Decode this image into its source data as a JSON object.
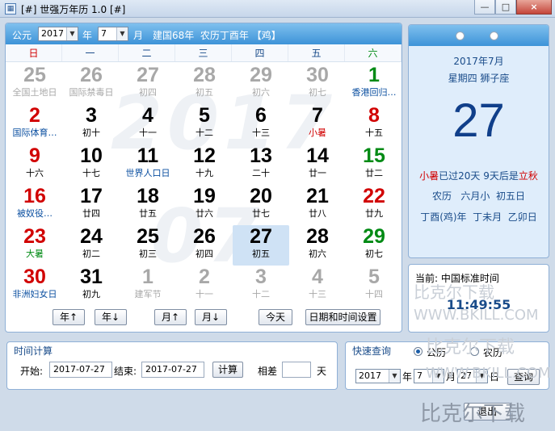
{
  "window": {
    "title": "[#] 世强万年历 1.0 [#]",
    "icon": "calendar-app-icon",
    "controls": [
      "—",
      "□",
      "×"
    ]
  },
  "header": {
    "calendar_type": "公元",
    "year": "2017",
    "year_unit": "年",
    "month": "7",
    "month_unit": "月",
    "info": "建国68年  农历丁酉年 【鸡】"
  },
  "weekdays": [
    "日",
    "一",
    "二",
    "三",
    "四",
    "五",
    "六"
  ],
  "watermark_year": "2017",
  "watermark_month": "07",
  "weeks": [
    [
      {
        "d": "25",
        "s": "全国土地日",
        "t": "o"
      },
      {
        "d": "26",
        "s": "国际禁毒日",
        "t": "o"
      },
      {
        "d": "27",
        "s": "初四",
        "t": "o"
      },
      {
        "d": "28",
        "s": "初五",
        "t": "o"
      },
      {
        "d": "29",
        "s": "初六",
        "t": "o"
      },
      {
        "d": "30",
        "s": "初七",
        "t": "o"
      },
      {
        "d": "1",
        "s": "香港回归…",
        "t": "g",
        "sc": "fest"
      }
    ],
    [
      {
        "d": "2",
        "s": "国际体育…",
        "t": "r",
        "sc": "fest"
      },
      {
        "d": "3",
        "s": "初十",
        "t": "n"
      },
      {
        "d": "4",
        "s": "十一",
        "t": "n"
      },
      {
        "d": "5",
        "s": "十二",
        "t": "n"
      },
      {
        "d": "6",
        "s": "十三",
        "t": "n"
      },
      {
        "d": "7",
        "s": "小暑",
        "t": "n",
        "sc": "term"
      },
      {
        "d": "8",
        "s": "十五",
        "t": "r"
      }
    ],
    [
      {
        "d": "9",
        "s": "十六",
        "t": "r"
      },
      {
        "d": "10",
        "s": "十七",
        "t": "n"
      },
      {
        "d": "11",
        "s": "世界人口日",
        "t": "n",
        "sc": "fest"
      },
      {
        "d": "12",
        "s": "十九",
        "t": "n"
      },
      {
        "d": "13",
        "s": "二十",
        "t": "n"
      },
      {
        "d": "14",
        "s": "廿一",
        "t": "n"
      },
      {
        "d": "15",
        "s": "廿二",
        "t": "g"
      }
    ],
    [
      {
        "d": "16",
        "s": "被奴役…",
        "t": "r",
        "sc": "fest"
      },
      {
        "d": "17",
        "s": "廿四",
        "t": "n"
      },
      {
        "d": "18",
        "s": "廿五",
        "t": "n"
      },
      {
        "d": "19",
        "s": "廿六",
        "t": "n"
      },
      {
        "d": "20",
        "s": "廿七",
        "t": "n"
      },
      {
        "d": "21",
        "s": "廿八",
        "t": "n"
      },
      {
        "d": "22",
        "s": "廿九",
        "t": "r"
      }
    ],
    [
      {
        "d": "23",
        "s": "大暑",
        "t": "r",
        "sc": "term2"
      },
      {
        "d": "24",
        "s": "初二",
        "t": "n"
      },
      {
        "d": "25",
        "s": "初三",
        "t": "n"
      },
      {
        "d": "26",
        "s": "初四",
        "t": "n"
      },
      {
        "d": "27",
        "s": "初五",
        "t": "n",
        "sel": true
      },
      {
        "d": "28",
        "s": "初六",
        "t": "n"
      },
      {
        "d": "29",
        "s": "初七",
        "t": "g"
      }
    ],
    [
      {
        "d": "30",
        "s": "非洲妇女日",
        "t": "r",
        "sc": "fest"
      },
      {
        "d": "31",
        "s": "初九",
        "t": "n"
      },
      {
        "d": "1",
        "s": "建军节",
        "t": "o"
      },
      {
        "d": "2",
        "s": "十一",
        "t": "o"
      },
      {
        "d": "3",
        "s": "十二",
        "t": "o"
      },
      {
        "d": "4",
        "s": "十三",
        "t": "o"
      },
      {
        "d": "5",
        "s": "十四",
        "t": "o"
      }
    ]
  ],
  "nav_buttons": {
    "year_up": "年↑",
    "year_down": "年↓",
    "month_up": "月↑",
    "month_down": "月↓",
    "today": "今天",
    "datetime_settings": "日期和时间设置"
  },
  "info": {
    "year_month": "2017年7月",
    "weekday_zodiac": "星期四  狮子座",
    "day": "27",
    "term_prefix": "小暑",
    "term_days": "已过20天  9天后是",
    "term_next": "立秋",
    "lunar": "农历   六月小  初五日",
    "ganzhi": "丁酉(鸡)年  丁未月  乙卯日"
  },
  "clock": {
    "label": "当前: 中国标准时间",
    "time": "11:49:55"
  },
  "timecalc": {
    "title": "时间计算",
    "start_label": "开始:",
    "start_value": "2017-07-27",
    "end_label": "结束:",
    "end_value": "2017-07-27",
    "calc_button": "计算",
    "diff_label": "相差",
    "diff_value": "",
    "unit": "天"
  },
  "quick": {
    "title": "快速查询",
    "opt_solar": "公历",
    "opt_lunar": "农历",
    "year": "2017",
    "year_unit": "年",
    "month": "7",
    "month_unit": "月",
    "day": "27",
    "day_unit": "日",
    "query_button": "查询"
  },
  "exit_button": "退出",
  "overlay_watermarks": [
    "比克尔下载",
    "WWW.BKILL.COM",
    "比克尔下载",
    "WWW.BKILL.COM",
    "比克尔下载"
  ],
  "colors": {
    "red": "#d10000",
    "green": "#008a14",
    "gray": "#a8a8a8",
    "blue_text": "#1a4c8a",
    "festival": "#0b4fa0"
  }
}
